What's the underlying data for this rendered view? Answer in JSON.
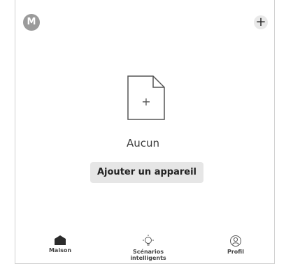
{
  "header": {
    "avatar_letter": "M",
    "add_symbol": "+"
  },
  "empty_state": {
    "doc_plus_symbol": "+",
    "title": "Aucun",
    "add_device_label": "Ajouter un appareil"
  },
  "bottom_nav": {
    "items": [
      {
        "label": "Maison",
        "icon": "house-icon"
      },
      {
        "label": "Scénarios intelligents",
        "icon": "lightbulb-icon"
      },
      {
        "label": "Profil",
        "icon": "user-icon"
      }
    ]
  },
  "colors": {
    "accent_gray": "#9b9b9b",
    "button_gray": "#e6e6e6"
  }
}
